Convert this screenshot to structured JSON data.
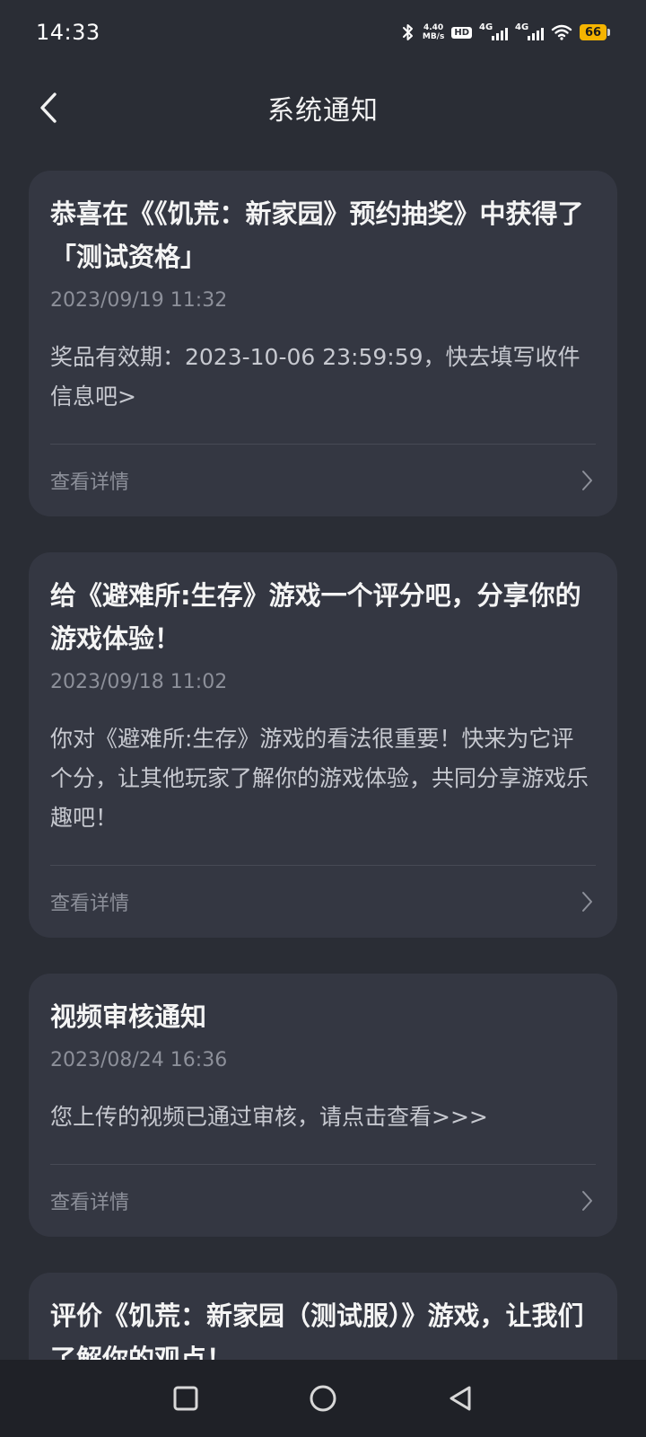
{
  "status_bar": {
    "time": "14:33",
    "net_speed_value": "4.40",
    "net_speed_unit": "MB/s",
    "hd_label": "HD",
    "signal1_label": "4G",
    "signal2_label": "4G",
    "battery_level": "66",
    "icons": [
      "bluetooth-icon",
      "hd-icon",
      "signal-icon",
      "signal-icon",
      "wifi-icon",
      "battery-icon"
    ]
  },
  "header": {
    "title": "系统通知",
    "back_icon": "chevron-left-icon"
  },
  "notifications": [
    {
      "title": "恭喜在《《饥荒：新家园》预约抽奖》中获得了「测试资格」",
      "time": "2023/09/19 11:32",
      "body": "奖品有效期：2023-10-06 23:59:59，快去填写收件信息吧>",
      "detail_label": "查看详情"
    },
    {
      "title": "给《避难所:生存》游戏一个评分吧，分享你的游戏体验！",
      "time": "2023/09/18 11:02",
      "body": "你对《避难所:生存》游戏的看法很重要！快来为它评个分，让其他玩家了解你的游戏体验，共同分享游戏乐趣吧！",
      "detail_label": "查看详情"
    },
    {
      "title": "视频审核通知",
      "time": "2023/08/24 16:36",
      "body": "您上传的视频已通过审核，请点击查看>>>",
      "detail_label": "查看详情"
    },
    {
      "title": "评价《饥荒：新家园（测试服）》游戏，让我们了解你的观点！",
      "time": "",
      "body": "",
      "detail_label": ""
    }
  ],
  "nav_bar": {
    "icons": [
      "square-icon",
      "circle-icon",
      "triangle-back-icon"
    ]
  },
  "colors": {
    "background": "#2a2d35",
    "card": "#343742",
    "battery": "#f5b400"
  }
}
